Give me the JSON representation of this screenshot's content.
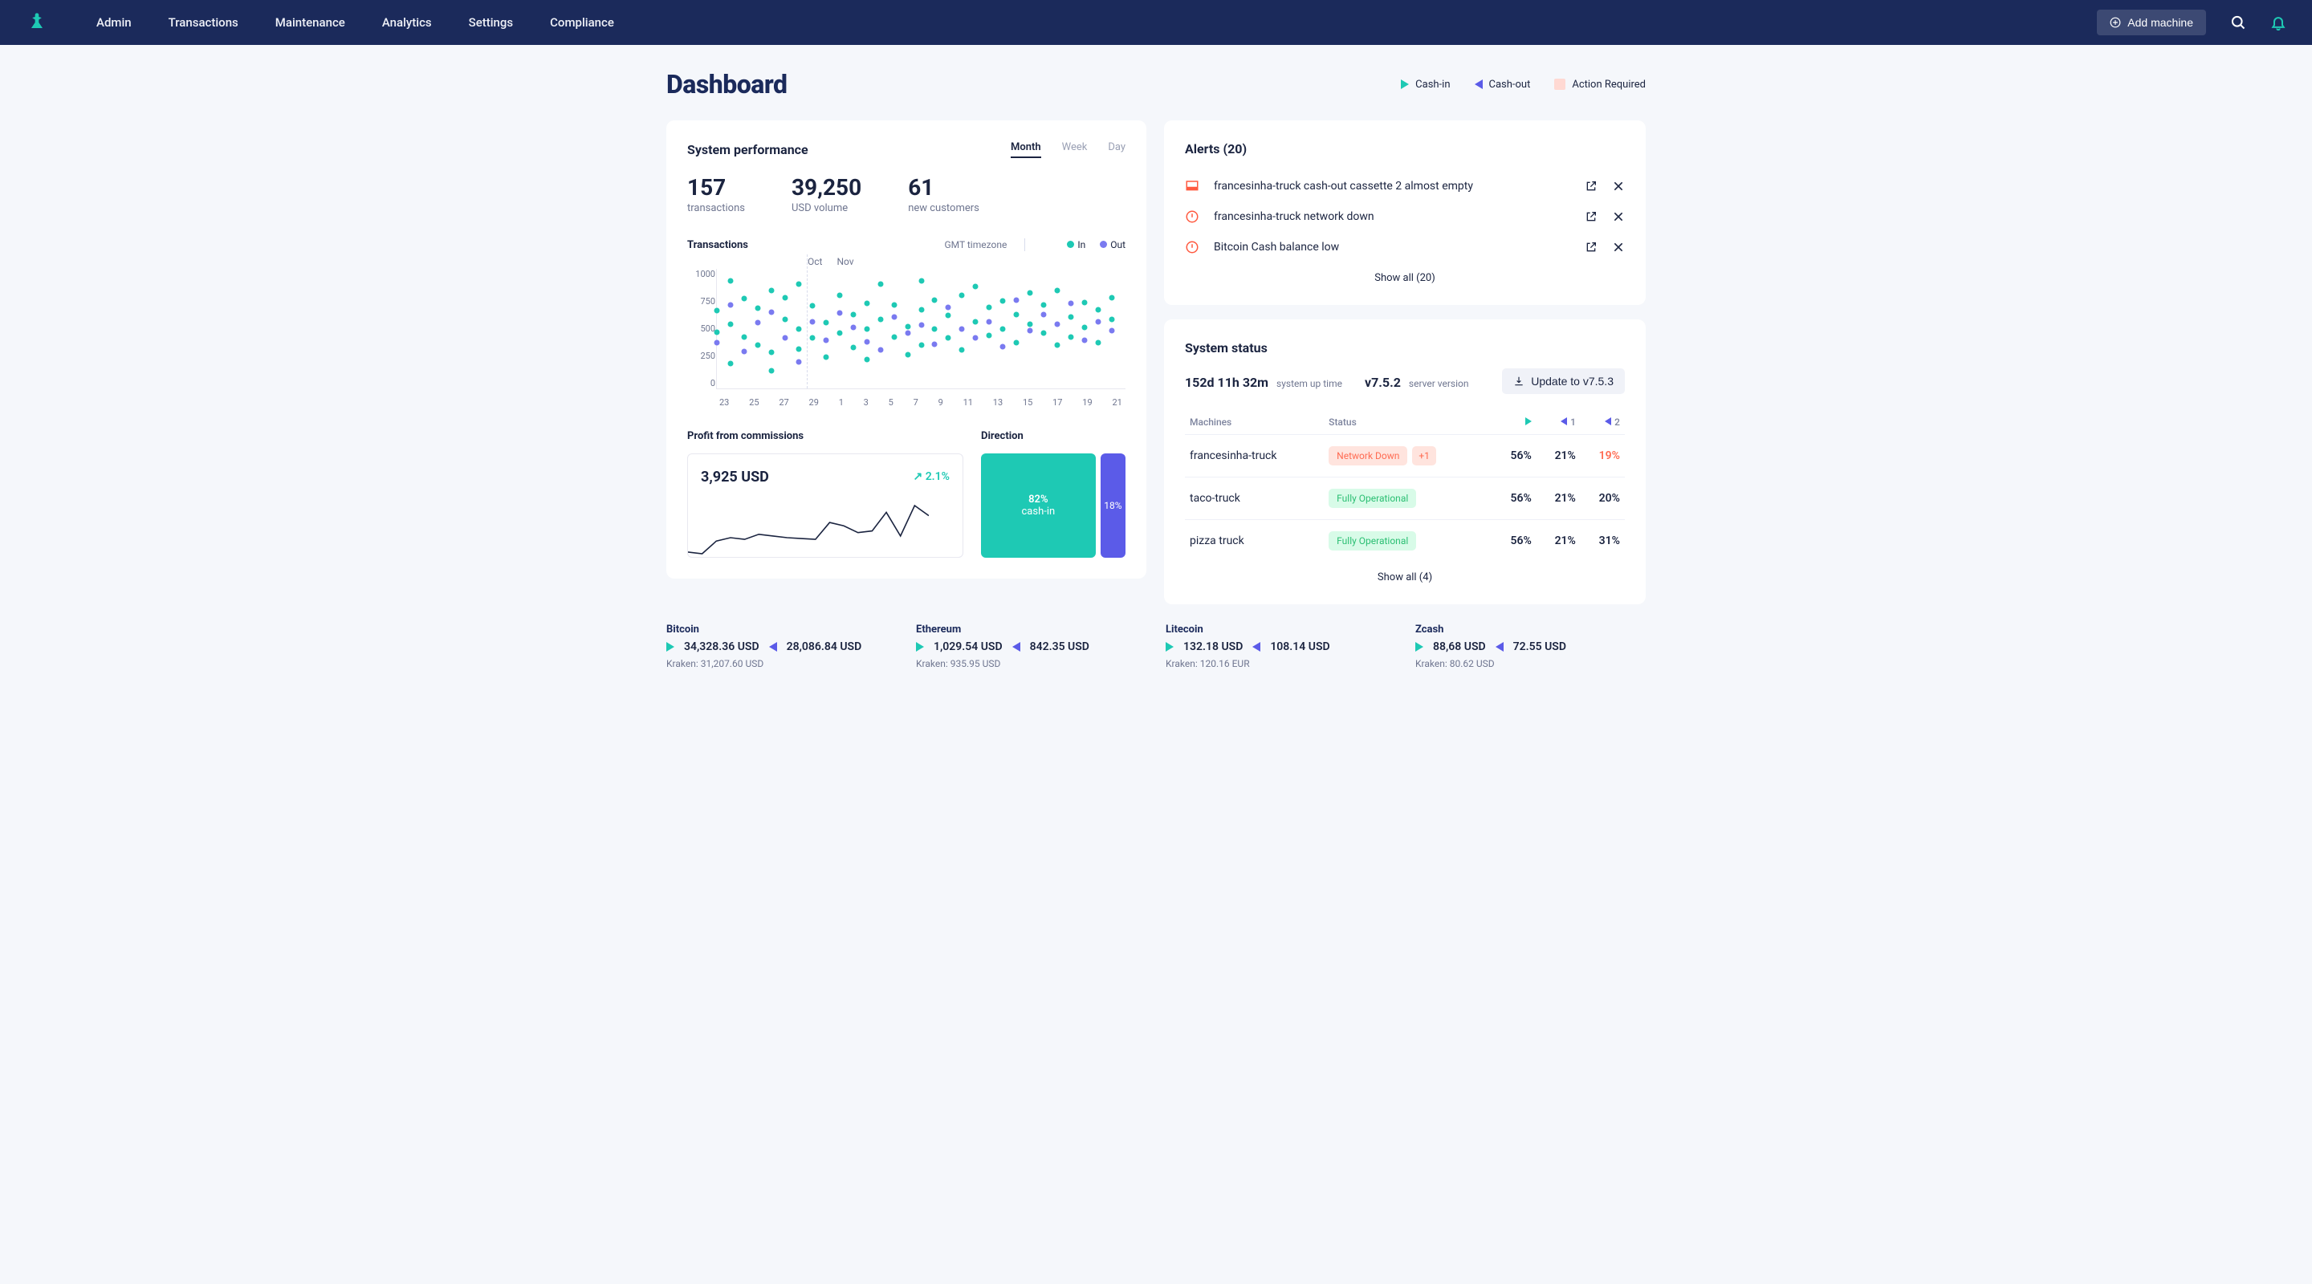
{
  "nav": {
    "items": [
      "Admin",
      "Transactions",
      "Maintenance",
      "Analytics",
      "Settings",
      "Compliance"
    ],
    "add_machine": "Add machine"
  },
  "page_title": "Dashboard",
  "legend": {
    "cash_in": "Cash-in",
    "cash_out": "Cash-out",
    "action_required": "Action Required"
  },
  "performance": {
    "title": "System performance",
    "tabs": [
      "Month",
      "Week",
      "Day"
    ],
    "active_tab": "Month",
    "stats": [
      {
        "value": "157",
        "label": "transactions"
      },
      {
        "value": "39,250",
        "label": "USD volume"
      },
      {
        "value": "61",
        "label": "new customers"
      }
    ],
    "chart_title": "Transactions",
    "timezone": "GMT timezone",
    "chart_legend": {
      "in": "In",
      "out": "Out"
    },
    "months": [
      "Oct",
      "Nov"
    ],
    "y_ticks": [
      "1000",
      "750",
      "500",
      "250",
      "0"
    ],
    "x_ticks": [
      "23",
      "25",
      "27",
      "29",
      "1",
      "3",
      "5",
      "7",
      "9",
      "11",
      "13",
      "15",
      "17",
      "19",
      "21"
    ],
    "vline_pct": 22,
    "profit": {
      "title": "Profit from commissions",
      "amount": "3,925 USD",
      "change": "2.1%",
      "change_icon": "↗"
    },
    "direction": {
      "title": "Direction",
      "in_pct": "82%",
      "in_label": "cash-in",
      "out_pct": "18%"
    }
  },
  "alerts": {
    "title": "Alerts (20)",
    "items": [
      {
        "type": "cassette",
        "text": "francesinha-truck cash-out cassette 2 almost empty"
      },
      {
        "type": "error",
        "text": "francesinha-truck network down"
      },
      {
        "type": "error",
        "text": "Bitcoin Cash balance low"
      }
    ],
    "show_all": "Show all (20)"
  },
  "status": {
    "title": "System status",
    "uptime": "152d 11h 32m",
    "uptime_label": "system up time",
    "version": "v7.5.2",
    "version_label": "server version",
    "update_btn": "Update to v7.5.3",
    "headers": {
      "machines": "Machines",
      "status": "Status",
      "c1": "1",
      "c2": "2"
    },
    "rows": [
      {
        "name": "francesinha-truck",
        "status": "Network Down",
        "status_type": "down",
        "extra": "+1",
        "p1": "56%",
        "p2": "21%",
        "p3": "19%",
        "p3_warn": true
      },
      {
        "name": "taco-truck",
        "status": "Fully Operational",
        "status_type": "ok",
        "p1": "56%",
        "p2": "21%",
        "p3": "20%"
      },
      {
        "name": "pizza truck",
        "status": "Fully Operational",
        "status_type": "ok",
        "p1": "56%",
        "p2": "21%",
        "p3": "31%"
      }
    ],
    "show_all": "Show all (4)"
  },
  "ticker": [
    {
      "name": "Bitcoin",
      "in": "34,328.36 USD",
      "out": "28,086.84 USD",
      "sub": "Kraken: 31,207.60 USD"
    },
    {
      "name": "Ethereum",
      "in": "1,029.54 USD",
      "out": "842.35 USD",
      "sub": "Kraken: 935.95 USD"
    },
    {
      "name": "Litecoin",
      "in": "132.18 USD",
      "out": "108.14 USD",
      "sub": "Kraken: 120.16 EUR"
    },
    {
      "name": "Zcash",
      "in": "88,68 USD",
      "out": "72.55 USD",
      "sub": "Kraken: 80.62 USD"
    }
  ],
  "chart_data": {
    "scatter": {
      "type": "scatter",
      "title": "Transactions",
      "ylim": [
        0,
        1000
      ],
      "x_range": [
        23,
        21
      ],
      "in": [
        [
          23,
          650
        ],
        [
          23,
          470
        ],
        [
          24,
          900
        ],
        [
          24,
          540
        ],
        [
          24,
          210
        ],
        [
          25,
          750
        ],
        [
          25,
          430
        ],
        [
          26,
          670
        ],
        [
          26,
          360
        ],
        [
          27,
          820
        ],
        [
          27,
          300
        ],
        [
          27,
          150
        ],
        [
          28,
          580
        ],
        [
          28,
          760
        ],
        [
          29,
          500
        ],
        [
          29,
          330
        ],
        [
          29,
          870
        ],
        [
          30,
          420
        ],
        [
          30,
          690
        ],
        [
          31,
          550
        ],
        [
          31,
          260
        ],
        [
          1,
          780
        ],
        [
          1,
          460
        ],
        [
          2,
          620
        ],
        [
          2,
          340
        ],
        [
          3,
          710
        ],
        [
          3,
          500
        ],
        [
          3,
          240
        ],
        [
          4,
          870
        ],
        [
          4,
          580
        ],
        [
          5,
          430
        ],
        [
          5,
          700
        ],
        [
          6,
          520
        ],
        [
          6,
          280
        ],
        [
          7,
          660
        ],
        [
          7,
          360
        ],
        [
          7,
          900
        ],
        [
          8,
          500
        ],
        [
          8,
          740
        ],
        [
          9,
          420
        ],
        [
          9,
          610
        ],
        [
          10,
          780
        ],
        [
          10,
          320
        ],
        [
          11,
          560
        ],
        [
          11,
          850
        ],
        [
          12,
          440
        ],
        [
          12,
          680
        ],
        [
          13,
          730
        ],
        [
          13,
          500
        ],
        [
          14,
          380
        ],
        [
          14,
          620
        ],
        [
          15,
          800
        ],
        [
          15,
          540
        ],
        [
          16,
          460
        ],
        [
          16,
          700
        ],
        [
          17,
          360
        ],
        [
          17,
          820
        ],
        [
          18,
          600
        ],
        [
          18,
          430
        ],
        [
          19,
          720
        ],
        [
          19,
          510
        ],
        [
          20,
          660
        ],
        [
          20,
          380
        ],
        [
          21,
          580
        ],
        [
          21,
          760
        ]
      ],
      "out": [
        [
          23,
          380
        ],
        [
          24,
          700
        ],
        [
          25,
          310
        ],
        [
          26,
          550
        ],
        [
          27,
          640
        ],
        [
          28,
          420
        ],
        [
          29,
          220
        ],
        [
          30,
          560
        ],
        [
          31,
          400
        ],
        [
          1,
          630
        ],
        [
          2,
          510
        ],
        [
          3,
          390
        ],
        [
          4,
          320
        ],
        [
          5,
          600
        ],
        [
          6,
          460
        ],
        [
          7,
          530
        ],
        [
          8,
          370
        ],
        [
          9,
          680
        ],
        [
          10,
          500
        ],
        [
          11,
          420
        ],
        [
          12,
          560
        ],
        [
          13,
          350
        ],
        [
          14,
          740
        ],
        [
          15,
          480
        ],
        [
          16,
          620
        ],
        [
          17,
          540
        ],
        [
          18,
          710
        ],
        [
          19,
          400
        ],
        [
          20,
          560
        ],
        [
          21,
          480
        ]
      ]
    },
    "profit_spark": {
      "type": "line",
      "values": [
        15,
        13,
        28,
        32,
        30,
        36,
        34,
        32,
        31,
        30,
        50,
        46,
        38,
        40,
        62,
        34,
        70,
        58
      ]
    },
    "direction_split": {
      "type": "bar",
      "cash_in": 82,
      "cash_out": 18
    }
  }
}
